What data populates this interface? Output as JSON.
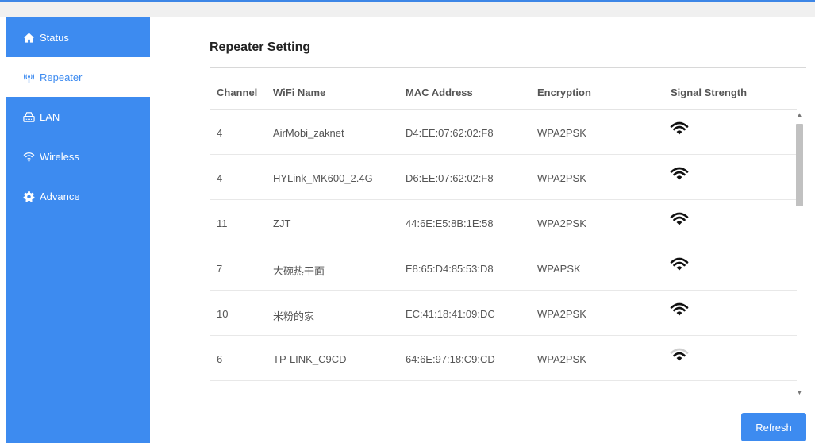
{
  "sidebar": {
    "items": [
      {
        "label": "Status",
        "icon": "home-icon"
      },
      {
        "label": "Repeater",
        "icon": "antenna-icon"
      },
      {
        "label": "LAN",
        "icon": "router-icon"
      },
      {
        "label": "Wireless",
        "icon": "wifi-icon"
      },
      {
        "label": "Advance",
        "icon": "gear-icon"
      }
    ],
    "active": "Repeater"
  },
  "main": {
    "title": "Repeater Setting",
    "columns": [
      "Channel",
      "WiFi Name",
      "MAC Address",
      "Encryption",
      "Signal Strength"
    ],
    "rows": [
      {
        "channel": "4",
        "name": "AirMobi_zaknet",
        "mac": "D4:EE:07:62:02:F8",
        "encryption": "WPA2PSK",
        "signal": 4
      },
      {
        "channel": "4",
        "name": "HYLink_MK600_2.4G",
        "mac": "D6:EE:07:62:02:F8",
        "encryption": "WPA2PSK",
        "signal": 4
      },
      {
        "channel": "11",
        "name": "ZJT",
        "mac": "44:6E:E5:8B:1E:58",
        "encryption": "WPA2PSK",
        "signal": 4
      },
      {
        "channel": "7",
        "name": "大碗热干面",
        "mac": "E8:65:D4:85:53:D8",
        "encryption": "WPAPSK",
        "signal": 4
      },
      {
        "channel": "10",
        "name": "米粉的家",
        "mac": "EC:41:18:41:09:DC",
        "encryption": "WPA2PSK",
        "signal": 4
      },
      {
        "channel": "6",
        "name": "TP-LINK_C9CD",
        "mac": "64:6E:97:18:C9:CD",
        "encryption": "WPA2PSK",
        "signal": 2
      }
    ],
    "refresh_label": "Refresh"
  },
  "colors": {
    "accent": "#3d8bf0",
    "signal_on": "#111111",
    "signal_off": "#cfcfcf"
  }
}
